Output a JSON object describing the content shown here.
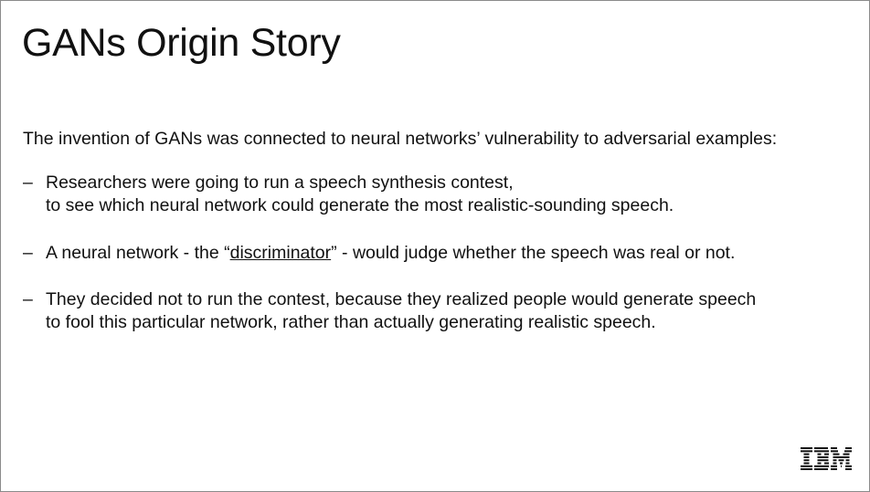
{
  "slide": {
    "title": "GANs Origin Story",
    "intro": "The invention of GANs was connected to neural networks’ vulnerability to adversarial examples:",
    "bullets": [
      {
        "marker": "–",
        "lines": [
          "Researchers were going to run a speech synthesis contest,",
          "to see which neural network could generate the most realistic-sounding speech."
        ]
      },
      {
        "marker": "–",
        "prefix": "A neural network - the “",
        "emphasis": "discriminator",
        "suffix": "” - would judge whether the speech was real or not."
      },
      {
        "marker": "–",
        "lines": [
          "They decided not to run the contest, because they realized people would generate speech",
          "to fool this particular network, rather than actually generating realistic speech."
        ]
      }
    ],
    "logo": {
      "name": "IBM",
      "icon": "ibm-logo-icon",
      "color": "#111111"
    }
  }
}
